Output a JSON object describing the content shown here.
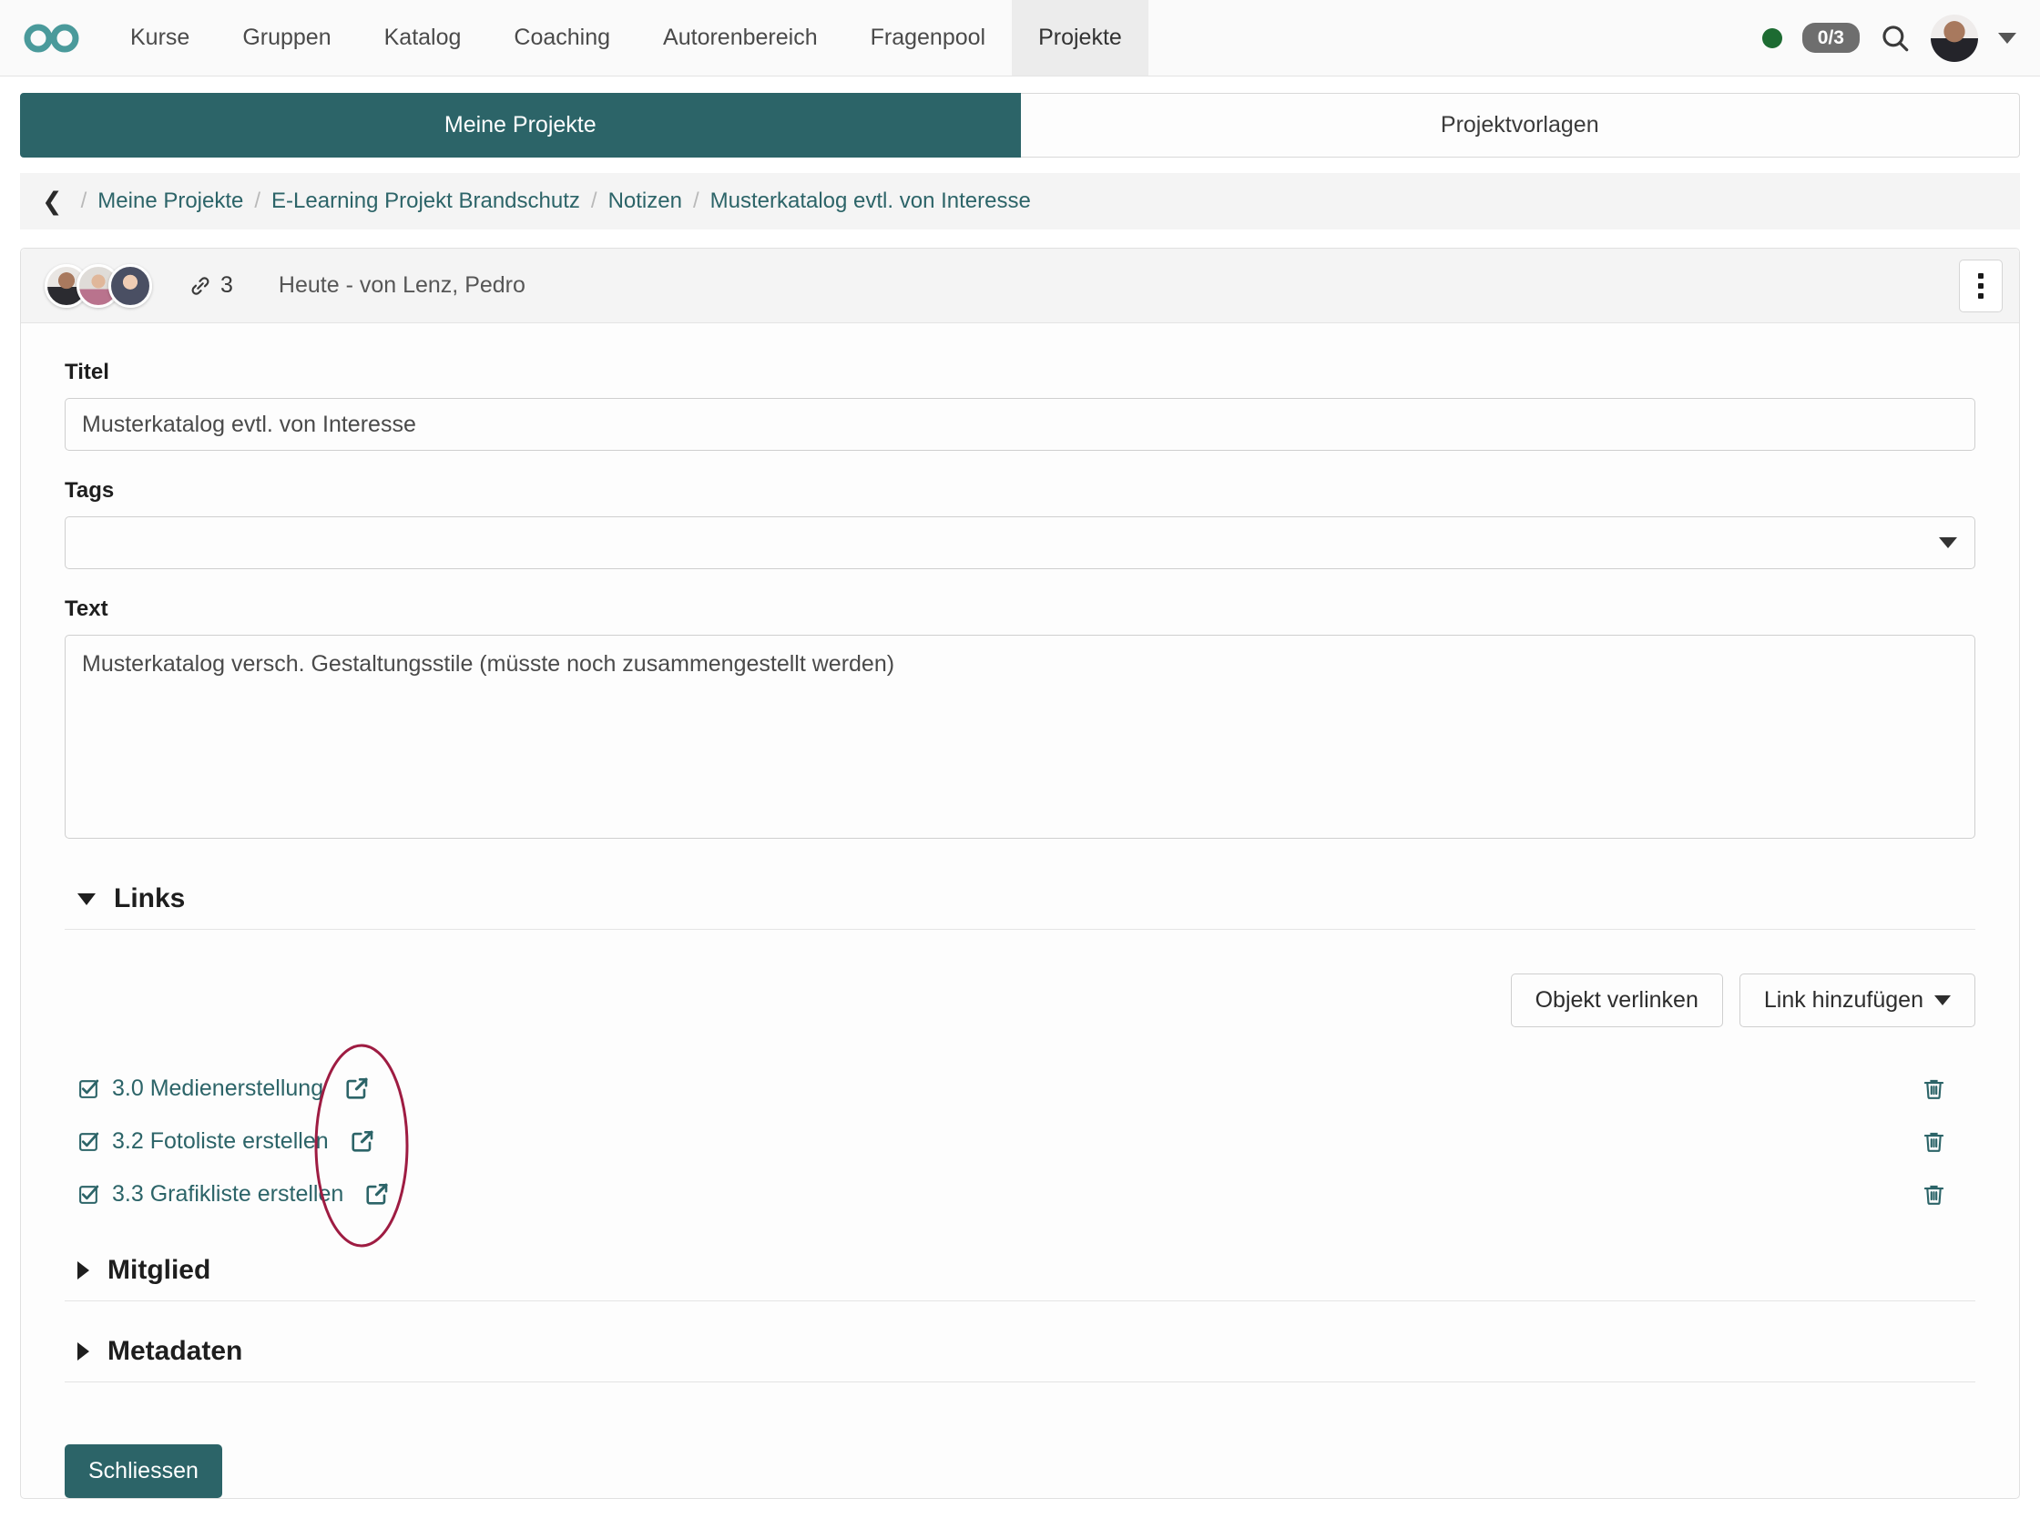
{
  "brand": {
    "logo_icon": "infinity-logo",
    "accent": "#2c6468"
  },
  "topnav": {
    "items": [
      {
        "label": "Kurse",
        "active": false
      },
      {
        "label": "Gruppen",
        "active": false
      },
      {
        "label": "Katalog",
        "active": false
      },
      {
        "label": "Coaching",
        "active": false
      },
      {
        "label": "Autorenbereich",
        "active": false
      },
      {
        "label": "Fragenpool",
        "active": false
      },
      {
        "label": "Projekte",
        "active": true
      }
    ],
    "status_dot_color": "#1d6b32",
    "count_badge": "0/3",
    "search_icon": "search-icon",
    "avatar_icon": "user-avatar",
    "caret_icon": "chevron-down-icon"
  },
  "tabs": [
    {
      "label": "Meine Projekte",
      "active": true
    },
    {
      "label": "Projektvorlagen",
      "active": false
    }
  ],
  "breadcrumb": {
    "back_icon": "chevron-left-icon",
    "separator": "/",
    "items": [
      "Meine Projekte",
      "E-Learning Projekt Brandschutz",
      "Notizen",
      "Musterkatalog evtl. von Interesse"
    ]
  },
  "note": {
    "avatars": [
      "member-1",
      "member-2",
      "member-3"
    ],
    "link_icon": "link-chain-icon",
    "link_count": "3",
    "meta": "Heute - von Lenz, Pedro",
    "kebab_icon": "more-options-icon"
  },
  "form": {
    "title_label": "Titel",
    "title_value": "Musterkatalog evtl. von Interesse",
    "tags_label": "Tags",
    "tags_value": "",
    "tags_caret_icon": "chevron-down-icon",
    "text_label": "Text",
    "text_value": "Musterkatalog versch. Gestaltungsstile (müsste noch zusammengestellt werden)"
  },
  "sections": {
    "links": {
      "title": "Links",
      "expanded": true,
      "toggle_icon": "triangle-down-icon"
    },
    "mitglied": {
      "title": "Mitglied",
      "expanded": false,
      "toggle_icon": "triangle-right-icon"
    },
    "metadaten": {
      "title": "Metadaten",
      "expanded": false,
      "toggle_icon": "triangle-right-icon"
    }
  },
  "links_actions": {
    "link_object_label": "Objekt verlinken",
    "add_link_label": "Link hinzufügen",
    "add_link_caret_icon": "caret-down-icon"
  },
  "links_list": [
    {
      "check_icon": "checkbox-checked-icon",
      "label": "3.0 Medienerstellung",
      "open_icon": "external-link-icon",
      "delete_icon": "trash-icon"
    },
    {
      "check_icon": "checkbox-checked-icon",
      "label": "3.2 Fotoliste erstellen",
      "open_icon": "external-link-icon",
      "delete_icon": "trash-icon"
    },
    {
      "check_icon": "checkbox-checked-icon",
      "label": "3.3 Grafikliste erstellen",
      "open_icon": "external-link-icon",
      "delete_icon": "trash-icon"
    }
  ],
  "annotation": {
    "shape": "ellipse",
    "color": "#9e1c42"
  },
  "footer": {
    "close_label": "Schliessen"
  }
}
